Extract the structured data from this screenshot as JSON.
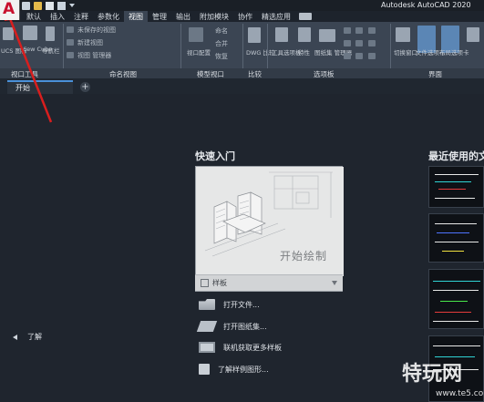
{
  "window": {
    "title": "Autodesk AutoCAD 2020",
    "app_button_letter": "A"
  },
  "ribbon": {
    "tabs": [
      "默认",
      "插入",
      "注释",
      "参数化",
      "视图",
      "管理",
      "输出",
      "附加模块",
      "协作",
      "精选应用"
    ],
    "active_tab": "视图",
    "panels": {
      "viewport_tools_label": "视口工具",
      "named_views_label": "命名视图",
      "model_viewports_label": "模型视口",
      "compare_label": "比较",
      "palettes_label": "选项板",
      "interface_label": "界面"
    },
    "named_view_items": [
      "未保存的视图",
      "新建视图",
      "视图 管理器"
    ],
    "tool_labels": {
      "ucs": "UCS 图标",
      "view_cube": "View Cube",
      "nav_bar": "导航栏",
      "viewport_config": "视口配置",
      "named": "命名",
      "merge": "合并",
      "restore": "恢复",
      "dwg_compare": "DWG 比较",
      "tool_palettes": "工具选项板",
      "properties": "特性",
      "sheet_set": "图纸集 管理器",
      "switch_windows": "切换窗口",
      "file_tabs": "文件选项卡",
      "layout_tabs": "布局选项卡"
    }
  },
  "file_tabs": {
    "start_tab": "开始",
    "add_tab": "+"
  },
  "quick_start": {
    "title": "快速入门",
    "card_text": "开始绘制",
    "template_label": "样板",
    "links": [
      "打开文件...",
      "打开图纸集...",
      "联机获取更多样板",
      "了解样例图形..."
    ]
  },
  "recent": {
    "title": "最近使用的文档"
  },
  "learn": {
    "label": "了解"
  },
  "watermark": {
    "text": "特玩网",
    "url": "www.te5.com"
  },
  "colors": {
    "annotation_arrow": "#d81e1e",
    "active_tab_underline": "#4a90d9"
  }
}
